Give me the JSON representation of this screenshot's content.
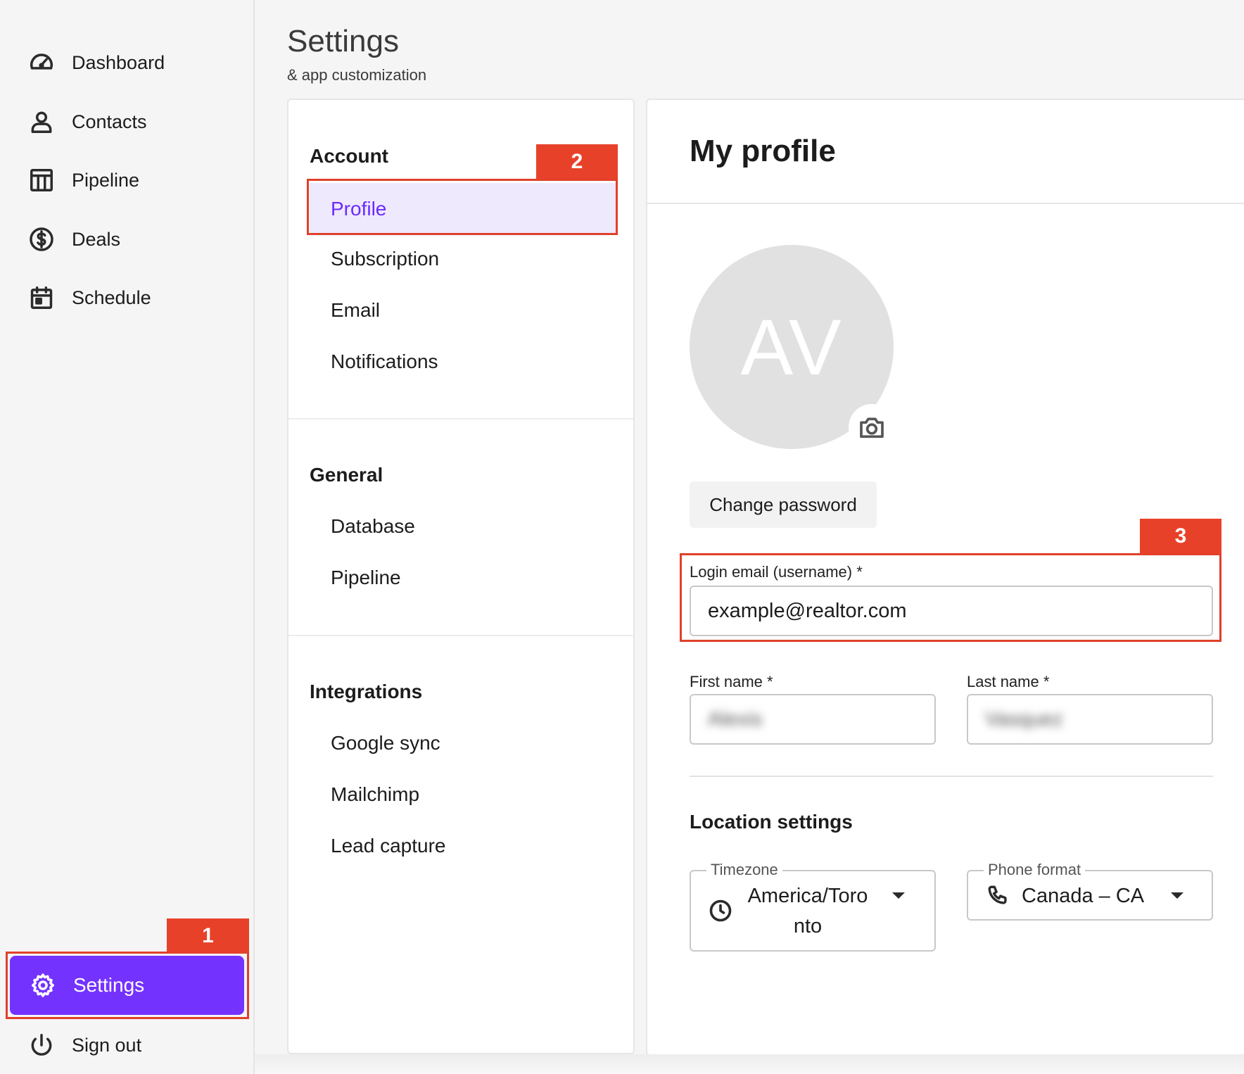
{
  "sidebar": {
    "items": [
      {
        "label": "Dashboard",
        "icon": "speedometer-icon"
      },
      {
        "label": "Contacts",
        "icon": "person-icon"
      },
      {
        "label": "Pipeline",
        "icon": "pipeline-board-icon"
      },
      {
        "label": "Deals",
        "icon": "dollar-circle-icon"
      },
      {
        "label": "Schedule",
        "icon": "calendar-icon"
      }
    ],
    "settings_label": "Settings",
    "signout_label": "Sign out"
  },
  "callouts": {
    "one": "1",
    "two": "2",
    "three": "3"
  },
  "header": {
    "title": "Settings",
    "subtitle": "& app customization"
  },
  "subnav": {
    "account_heading": "Account",
    "account_items": [
      "Profile",
      "Subscription",
      "Email",
      "Notifications"
    ],
    "general_heading": "General",
    "general_items": [
      "Database",
      "Pipeline"
    ],
    "integrations_heading": "Integrations",
    "integrations_items": [
      "Google sync",
      "Mailchimp",
      "Lead capture"
    ]
  },
  "profile": {
    "title": "My profile",
    "avatar_initials": "AV",
    "change_password_label": "Change password",
    "login_email_label": "Login email (username) *",
    "login_email_value": "example@realtor.com",
    "first_name_label": "First name *",
    "first_name_value": "Alexis",
    "last_name_label": "Last name *",
    "last_name_value": "Vasquez",
    "location_title": "Location settings",
    "timezone_label": "Timezone",
    "timezone_value": "America/Toronto",
    "phone_format_label": "Phone format",
    "phone_format_value": "Canada – CA"
  },
  "colors": {
    "accent": "#7432ff",
    "active_bg": "#efe9fd",
    "active_text": "#6b2bff",
    "callout": "#e8412a"
  }
}
